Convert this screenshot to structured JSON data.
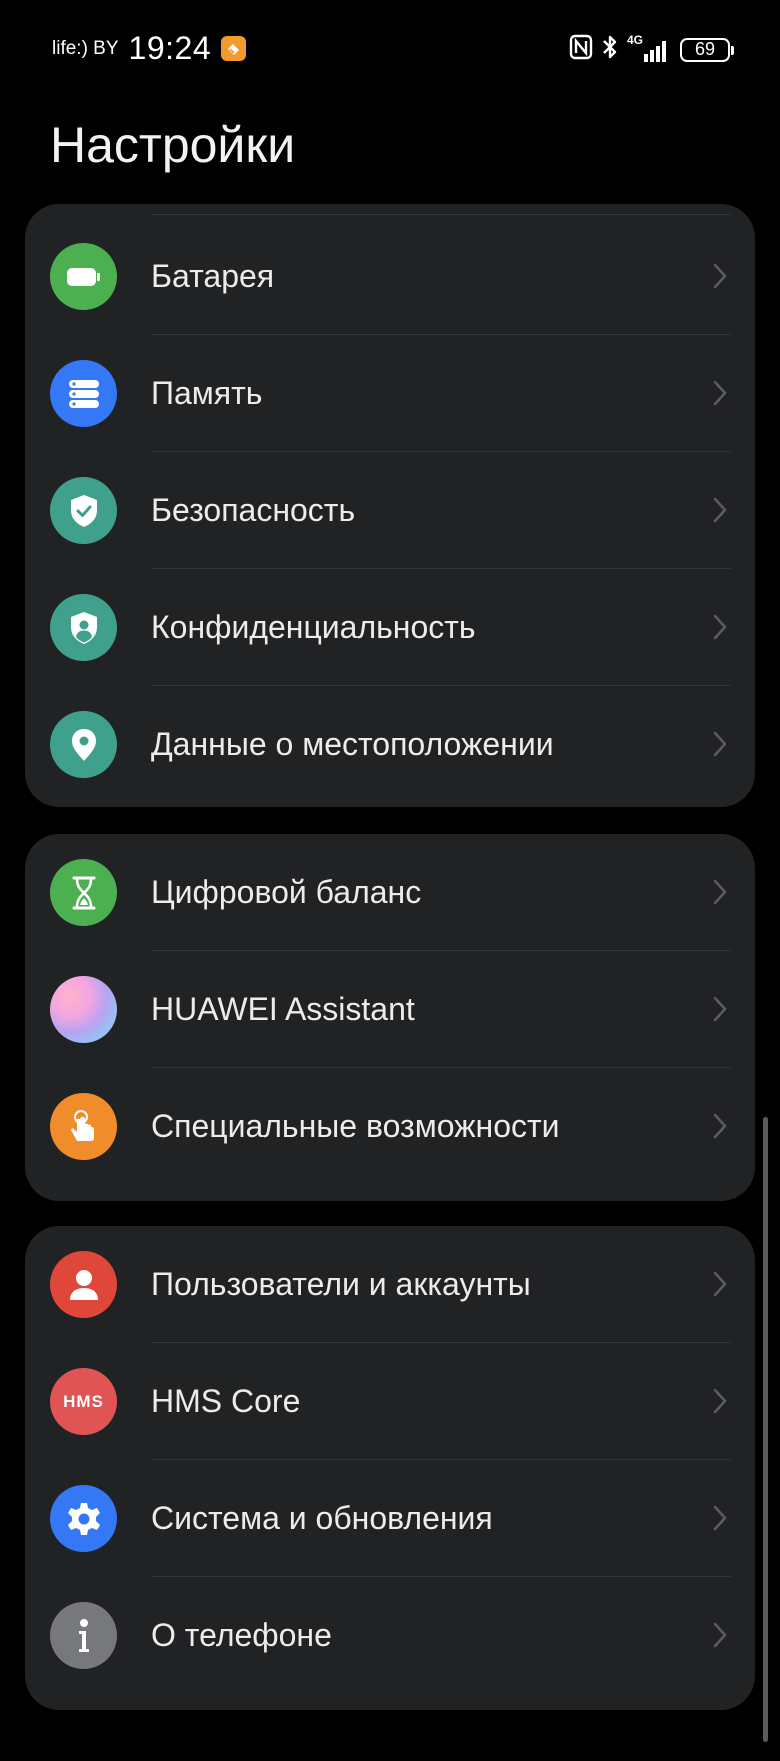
{
  "status_bar": {
    "carrier": "life:) BY",
    "time": "19:24",
    "network": "4G",
    "battery": "69"
  },
  "page_title": "Настройки",
  "groups": [
    {
      "items": [
        {
          "label": "Батарея",
          "icon": "battery-icon",
          "color": "#4caf50"
        },
        {
          "label": "Память",
          "icon": "storage-icon",
          "color": "#3478f6"
        },
        {
          "label": "Безопасность",
          "icon": "shield-check-icon",
          "color": "#3fa18c"
        },
        {
          "label": "Конфиденциальность",
          "icon": "privacy-shield-icon",
          "color": "#3fa18c"
        },
        {
          "label": "Данные о местоположении",
          "icon": "location-pin-icon",
          "color": "#3fa18c"
        }
      ]
    },
    {
      "items": [
        {
          "label": "Цифровой баланс",
          "icon": "hourglass-icon",
          "color": "#4caf50"
        },
        {
          "label": "HUAWEI Assistant",
          "icon": "huawei-assistant-icon",
          "color": "#c9a2e8"
        },
        {
          "label": "Специальные возможности",
          "icon": "accessibility-hand-icon",
          "color": "#f08c2a"
        }
      ]
    },
    {
      "items": [
        {
          "label": "Пользователи и аккаунты",
          "icon": "user-icon",
          "color": "#e0473b"
        },
        {
          "label": "HMS Core",
          "icon": "hms-core-icon",
          "icon_text": "HMS",
          "color": "#e05454"
        },
        {
          "label": "Система и обновления",
          "icon": "gear-icon",
          "color": "#3478f6"
        },
        {
          "label": "О телефоне",
          "icon": "info-icon",
          "color": "#77787b"
        }
      ]
    }
  ]
}
